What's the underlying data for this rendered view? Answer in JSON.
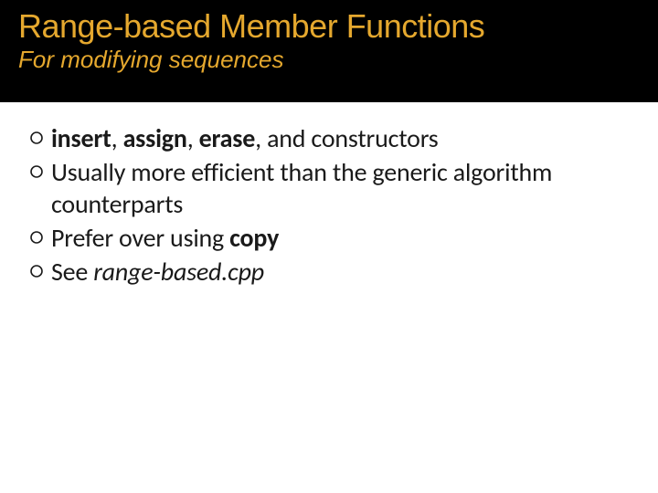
{
  "colors": {
    "accent": "#e5a82e",
    "header_bg": "#000000",
    "body_text": "#1a1a1a"
  },
  "header": {
    "title": "Range-based Member Functions",
    "subtitle": "For modifying sequences"
  },
  "body": {
    "bullets": [
      {
        "segments": [
          {
            "text": "insert",
            "bold": true
          },
          {
            "text": ", "
          },
          {
            "text": "assign",
            "bold": true
          },
          {
            "text": ", "
          },
          {
            "text": "erase",
            "bold": true
          },
          {
            "text": ", and constructors"
          }
        ]
      },
      {
        "segments": [
          {
            "text": "Usually more efficient than the generic algorithm counterparts"
          }
        ]
      },
      {
        "segments": [
          {
            "text": "Prefer over using "
          },
          {
            "text": "copy",
            "bold": true
          }
        ]
      },
      {
        "segments": [
          {
            "text": "See "
          },
          {
            "text": "range-based.cpp",
            "italic": true
          }
        ]
      }
    ]
  }
}
